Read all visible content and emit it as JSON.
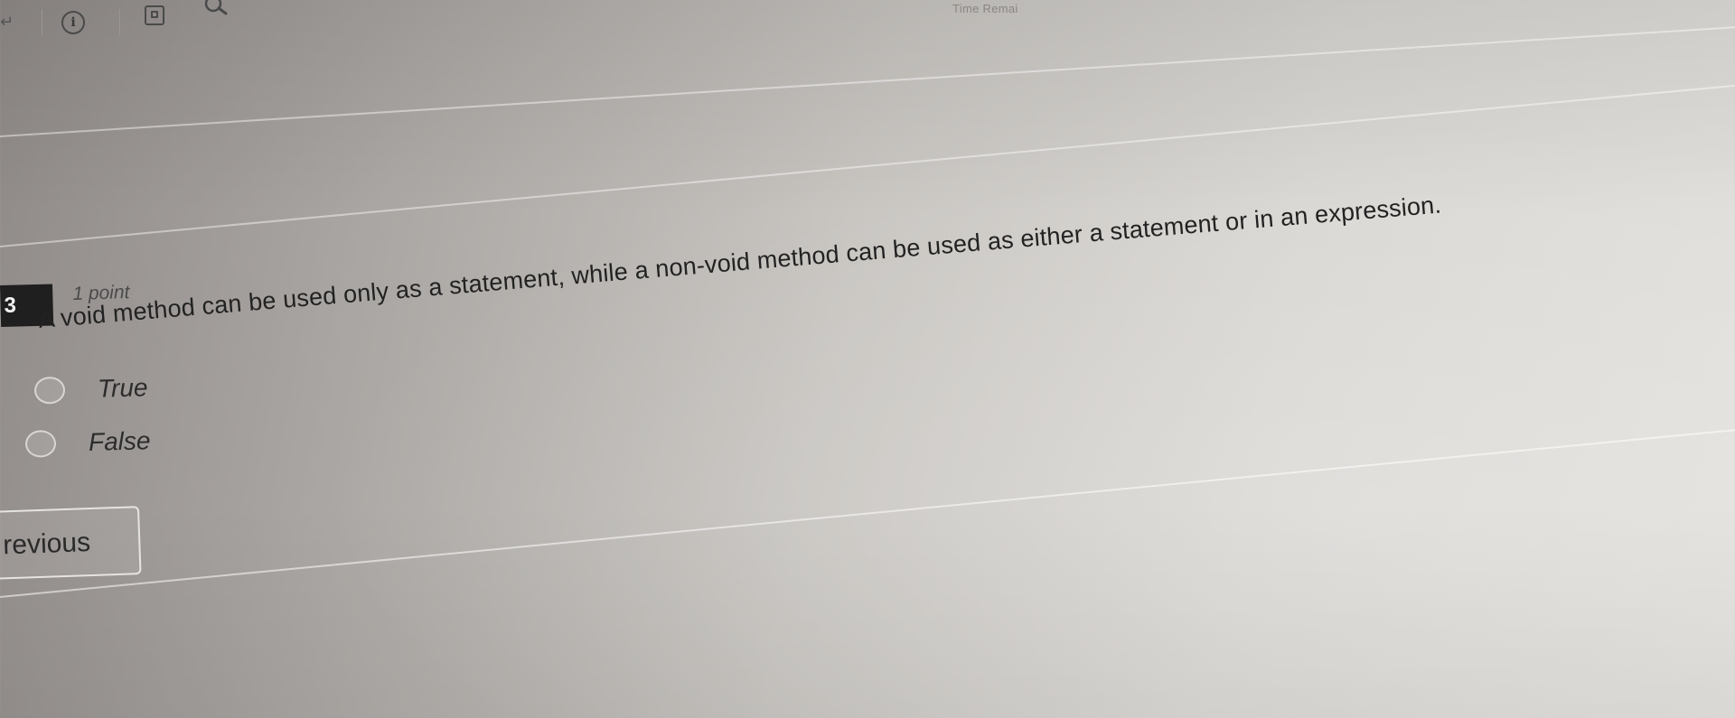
{
  "header": {
    "time_label": "Time Remai"
  },
  "icons": {
    "back": "back-arrow-icon",
    "info": "info-icon",
    "info_glyph": "i",
    "calculator": "calculator-icon",
    "search": "search-icon"
  },
  "question": {
    "number": "3",
    "points": "1 point",
    "text": "A void method can be used only as a statement, while a non-void method can be used as either a statement or in an expression.",
    "options": [
      {
        "label": "True"
      },
      {
        "label": "False"
      }
    ]
  },
  "navigation": {
    "previous_label": "revious"
  },
  "colors": {
    "number_badge": "#1f1f1f",
    "text": "#222222"
  }
}
